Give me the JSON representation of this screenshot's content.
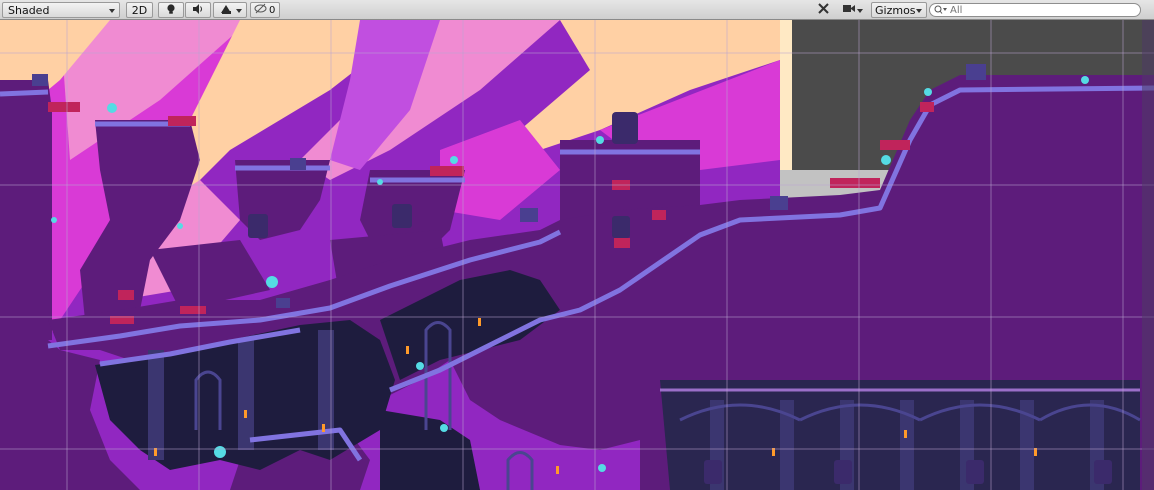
{
  "toolbar": {
    "shading_mode": "Shaded",
    "mode_2d": "2D",
    "gizmos_label": "Gizmos",
    "hidden_count": "0",
    "search_placeholder": "All"
  },
  "icons": {
    "lighting": "lightbulb-icon",
    "audio": "speaker-icon",
    "effects": "effects-icon",
    "hidden_layers": "eye-slash-icon",
    "tools": "tools-icon",
    "camera": "camera-icon",
    "search": "search-icon"
  },
  "colors": {
    "toolbar_bg": "#d6d6d6",
    "sky_purple": "#9127c1",
    "sky_magenta": "#d93ad6",
    "sky_pink": "#f08bd2",
    "sky_cream": "#ffd0a4",
    "rock_purple": "#5d1c7b",
    "rock_edge": "#8173e0",
    "crystal_cyan": "#55dbe4",
    "cave_dark": "#1e1c3e",
    "brick_pink": "#c0245b",
    "grid_line": "#b9a4cf",
    "empty_area": "#4b4b4b"
  }
}
